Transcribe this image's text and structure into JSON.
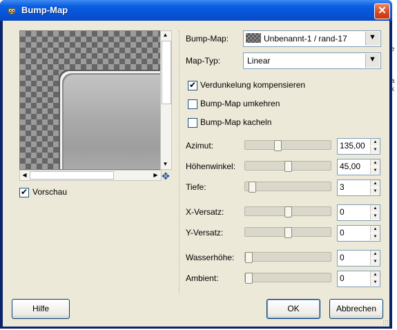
{
  "window": {
    "title": "Bump-Map",
    "close_glyph": "✕",
    "icon": "gimp-icon"
  },
  "preview": {
    "checkbox_label": "Vorschau",
    "checked": true,
    "nav_icon": "navigate-icon"
  },
  "map": {
    "bump_map_label": "Bump-Map:",
    "bump_map_value": "Unbenannt-1 / rand-17",
    "map_type_label": "Map-Typ:",
    "map_type_value": "Linear"
  },
  "options": [
    {
      "label": "Verdunkelung kompensieren",
      "checked": true
    },
    {
      "label": "Bump-Map umkehren",
      "checked": false
    },
    {
      "label": "Bump-Map kacheln",
      "checked": false
    }
  ],
  "sliders": [
    {
      "label": "Azimut:",
      "value": "135,00",
      "fraction": 0.375
    },
    {
      "label": "Höhenwinkel:",
      "value": "45,00",
      "fraction": 0.5
    },
    {
      "label": "Tiefe:",
      "value": "3",
      "fraction": 0.04
    },
    {
      "label": "X-Versatz:",
      "value": "0",
      "fraction": 0.5
    },
    {
      "label": "Y-Versatz:",
      "value": "0",
      "fraction": 0.5
    },
    {
      "label": "Wasserhöhe:",
      "value": "0",
      "fraction": 0.0
    },
    {
      "label": "Ambient:",
      "value": "0",
      "fraction": 0.0
    }
  ],
  "buttons": {
    "help": "Hilfe",
    "ok": "OK",
    "cancel": "Abbrechen"
  },
  "background_app": {
    "snippets": [
      "e",
      "a",
      "k"
    ]
  }
}
